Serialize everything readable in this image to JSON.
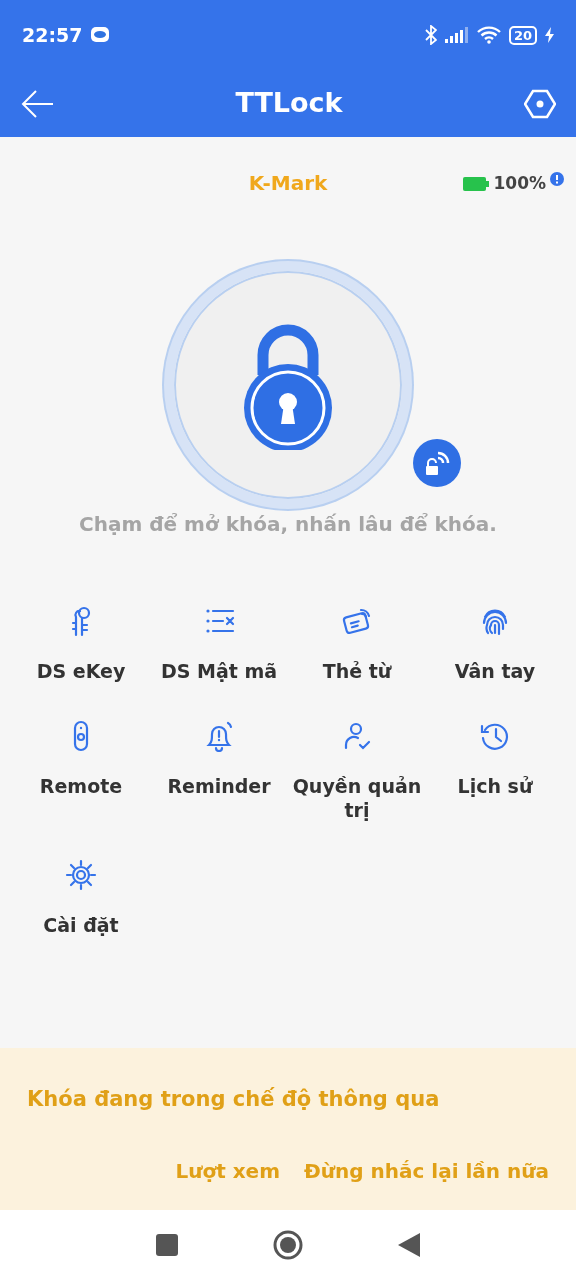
{
  "status_bar": {
    "time": "22:57",
    "battery": "20"
  },
  "app_bar": {
    "title": "TTLock"
  },
  "lock": {
    "name": "K-Mark",
    "battery": "100%",
    "hint": "Chạm để mở khóa, nhấn lâu để khóa."
  },
  "menu": [
    {
      "label": "DS eKey",
      "kind": "ekey"
    },
    {
      "label": "DS Mật mã",
      "kind": "passcode"
    },
    {
      "label": "Thẻ từ",
      "kind": "card"
    },
    {
      "label": "Vân tay",
      "kind": "fingerprint"
    },
    {
      "label": "Remote",
      "kind": "remote"
    },
    {
      "label": "Reminder",
      "kind": "reminder"
    },
    {
      "label": "Quyền quản trị",
      "kind": "admin"
    },
    {
      "label": "Lịch sử",
      "kind": "history"
    },
    {
      "label": "Cài đặt",
      "kind": "settings"
    }
  ],
  "banner": {
    "message": "Khóa đang trong chế độ thông qua",
    "actions": [
      "Lượt xem",
      "Đừng nhắc lại lần nữa"
    ]
  }
}
